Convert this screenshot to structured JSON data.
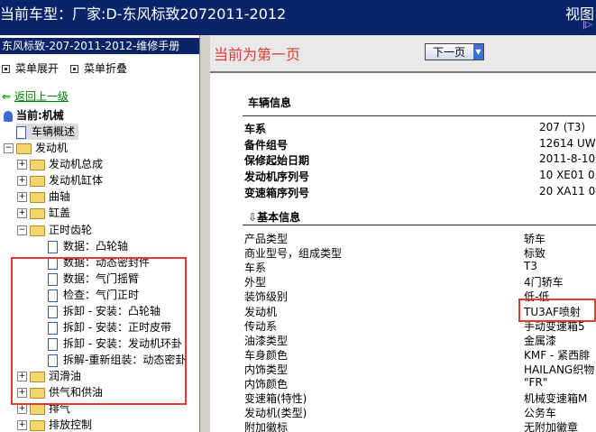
{
  "window": {
    "title": "当前车型：厂家:D-东风标致2072011-2012",
    "view_label": "视图",
    "mini": "|▷"
  },
  "sidebar": {
    "manual_title": "东风标致-207-2011-2012-维修手册",
    "expand_menu": "菜单展开",
    "collapse_menu": "菜单折叠",
    "back": "返回上一级",
    "current": "当前:机械",
    "items": [
      {
        "label": "车辆概述"
      },
      {
        "label": "发动机"
      },
      {
        "label": "发动机总成"
      },
      {
        "label": "发动机缸体"
      },
      {
        "label": "曲轴"
      },
      {
        "label": "缸盖"
      },
      {
        "label": "正时齿轮"
      },
      {
        "label": "数据：凸轮轴"
      },
      {
        "label": "数据：动态密封件"
      },
      {
        "label": "数据：气门摇臂"
      },
      {
        "label": "检查：气门正时"
      },
      {
        "label": "拆卸 - 安装：凸轮轴"
      },
      {
        "label": "拆卸 - 安装：正时皮带"
      },
      {
        "label": "拆卸 - 安装：发动机环卦"
      },
      {
        "label": "拆解-重新组装：动态密卦"
      },
      {
        "label": "润滑油"
      },
      {
        "label": "供气和供油"
      },
      {
        "label": "排气"
      },
      {
        "label": "排放控制"
      }
    ]
  },
  "main": {
    "current_page": "当前为第一页",
    "next_button": "下一页",
    "vehicle_info": {
      "title": "车辆信息",
      "rows": [
        {
          "label": "车系",
          "value": "207 (T3)"
        },
        {
          "label": "备件组号",
          "value": "12614 UW"
        },
        {
          "label": "保修起始日期",
          "value": "2011-8-10"
        },
        {
          "label": "发动机序列号",
          "value": "10 XE01 0"
        },
        {
          "label": "变速箱序列号",
          "value": "20 XA11 0"
        }
      ]
    },
    "basic_info": {
      "title": "基本信息",
      "rows": [
        {
          "label": "产品类型",
          "value": "轿车"
        },
        {
          "label": "商业型号，组成类型",
          "value": "标致"
        },
        {
          "label": "车系",
          "value": "T3"
        },
        {
          "label": "外型",
          "value": "4门轿车"
        },
        {
          "label": "装饰级别",
          "value": "低-低"
        },
        {
          "label": "发动机",
          "value": "TU3AF喷射"
        },
        {
          "label": "传动系",
          "value": "手动变速箱5"
        },
        {
          "label": "油漆类型",
          "value": "金属漆"
        },
        {
          "label": "车身颜色",
          "value": "KMF - 紧西腓"
        },
        {
          "label": "内饰类型",
          "value": "HAILANG织物"
        },
        {
          "label": "内饰颜色",
          "value": "\"FR\""
        },
        {
          "label": "变速箱(特性)",
          "value": "机械变速箱M"
        },
        {
          "label": "发动机(类型)",
          "value": "公务车"
        },
        {
          "label": "附加徽标",
          "value": "无附加徽章"
        }
      ]
    }
  }
}
